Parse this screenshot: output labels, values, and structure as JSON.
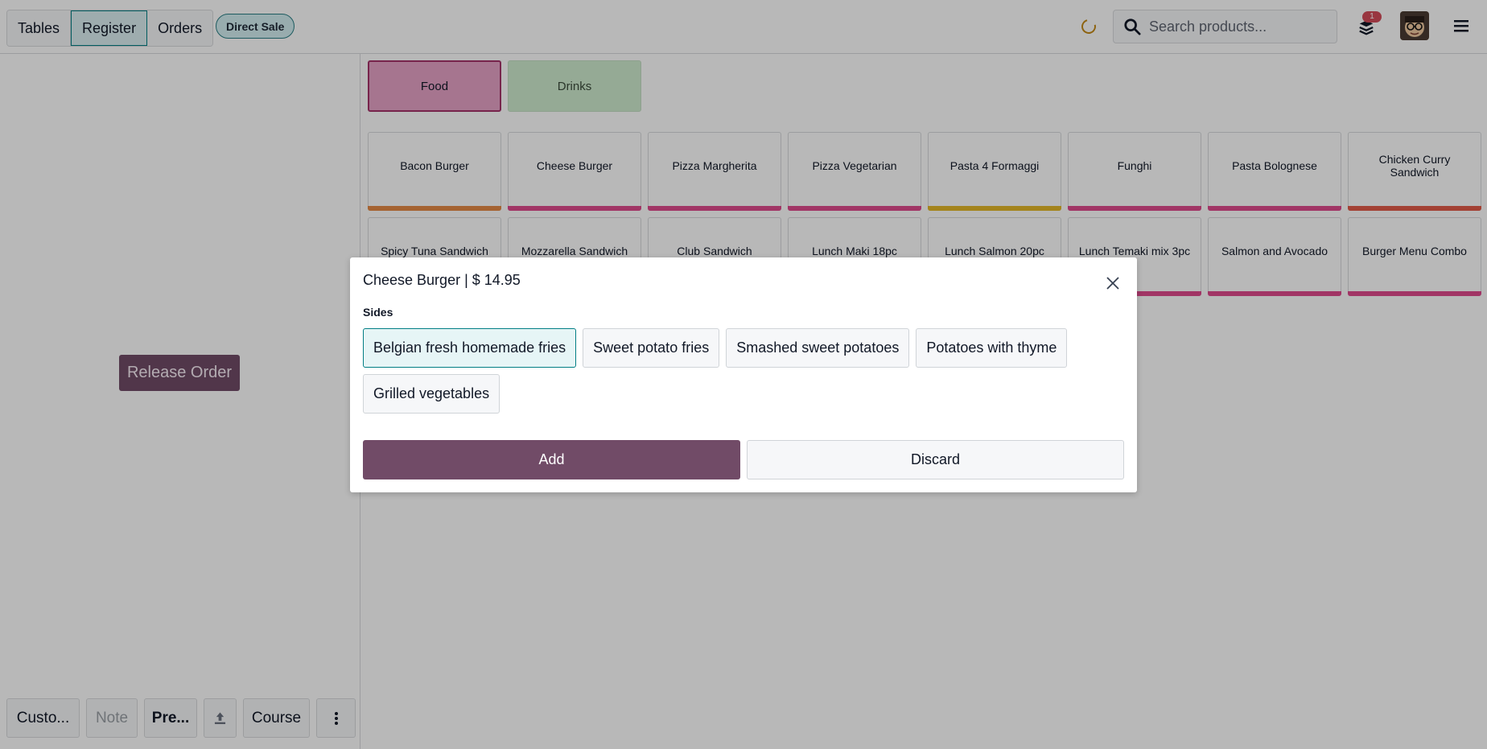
{
  "topbar": {
    "nav": [
      "Tables",
      "Register",
      "Orders"
    ],
    "active_nav": "Register",
    "direct_sale_label": "Direct Sale",
    "search": {
      "placeholder": "Search products..."
    },
    "notification_count": "1"
  },
  "left_pane": {
    "release_order_label": "Release Order",
    "bottom_buttons": [
      "Custo...",
      "Note",
      "Pre...",
      "Course"
    ]
  },
  "categories": [
    {
      "label": "Food"
    },
    {
      "label": "Drinks"
    }
  ],
  "products": [
    {
      "name": "Bacon Burger",
      "color": "#e58a46"
    },
    {
      "name": "Cheese Burger",
      "color": "#e04a8c"
    },
    {
      "name": "Pizza Margherita",
      "color": "#e04a8c"
    },
    {
      "name": "Pizza Vegetarian",
      "color": "#e04a8c"
    },
    {
      "name": "Pasta 4 Formaggi",
      "color": "#e4b829"
    },
    {
      "name": "Funghi",
      "color": "#e04a8c"
    },
    {
      "name": "Pasta Bolognese",
      "color": "#e04a8c"
    },
    {
      "name": "Chicken Curry Sandwich",
      "color": "#e25a48"
    },
    {
      "name": "Spicy Tuna Sandwich",
      "color": "#e04a8c"
    },
    {
      "name": "Mozzarella Sandwich",
      "color": "#e04a8c"
    },
    {
      "name": "Club Sandwich",
      "color": "#e04a8c"
    },
    {
      "name": "Lunch Maki 18pc",
      "color": "#e04a8c"
    },
    {
      "name": "Lunch Salmon 20pc",
      "color": "#e04a8c"
    },
    {
      "name": "Lunch Temaki mix 3pc",
      "color": "#e04a8c"
    },
    {
      "name": "Salmon and Avocado",
      "color": "#e04a8c"
    },
    {
      "name": "Burger Menu Combo",
      "color": "#e04a8c"
    }
  ],
  "dialog": {
    "title": "Cheese Burger | $ 14.95",
    "section": "Sides",
    "options": [
      "Belgian fresh homemade fries",
      "Sweet potato fries",
      "Smashed sweet potatoes",
      "Potatoes with thyme",
      "Grilled vegetables"
    ],
    "selected": "Belgian fresh homemade fries",
    "add_label": "Add",
    "discard_label": "Discard"
  },
  "colors": {
    "accent": "#714b67",
    "teal": "#017e84"
  }
}
